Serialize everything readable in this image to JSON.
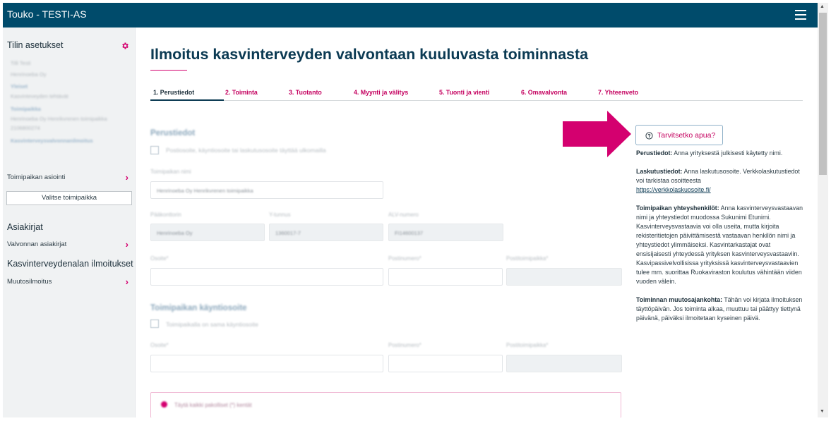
{
  "app": {
    "title": "Touko - TESTI-AS"
  },
  "sidebar": {
    "account_title": "Tilin asetukset",
    "account_blurred_lines": [
      "Tilli Testi",
      "Henrinoeba Oy",
      "Yleiset",
      "Kasvinteveyden tehtävät",
      "Toimipaikka",
      "Henrinoeba Oy Henrikvrenen toimipaikka",
      "2106800274",
      "Kasvinterveysvalvonnanilmoitus"
    ],
    "location_item": "Toimipaikan asiointi",
    "select_location_button": "Valitse toimipaikka",
    "documents_title": "Asiakirjat",
    "documents_item": "Valvonnan asiakirjat",
    "notifications_title": "Kasvinterveydenalan ilmoitukset",
    "notifications_item": "Muutosilmoitus"
  },
  "main": {
    "page_title": "Ilmoitus kasvinterveyden valvontaan kuuluvasta toiminnasta",
    "steps": [
      "1. Perustiedot",
      "2. Toiminta",
      "3. Tuotanto",
      "4. Myynti ja välitys",
      "5. Tuonti ja vienti",
      "6. Omavalvonta",
      "7. Yhteenveto"
    ],
    "form": {
      "section1_heading": "Perustiedot",
      "checkbox1_label": "Postiosoite, käyntiosoite tai laskutusosoite täyttää ulkomailla",
      "location_name_label": "Toimipaikan nimi",
      "location_name_value": "Henrinoeba Oy Henrikvrenen toimipaikka",
      "company_name_label": "Pääkonttorin",
      "company_name_value": "Henrinoeba Oy",
      "business_id_label": "Y-tunnus",
      "business_id_value": "1360017-7",
      "vat_label": "ALV-numero",
      "vat_value": "FI14600137",
      "address_label": "Osoite*",
      "postcode_label": "Postinumero*",
      "city_label": "Postitoimipaikka*",
      "section2_heading": "Toimipaikan käyntiosoite",
      "checkbox2_label": "Toimipaikalla on sama käyntiosoite",
      "address2_label": "Osoite*",
      "postcode2_label": "Postinumero*",
      "city2_label": "Postitoimipaikka*",
      "alert_text": "Täytä kaikki pakolliset (*) kentät"
    },
    "help": {
      "button_label": "Tarvitsetko apua?",
      "paragraphs": [
        {
          "title": "Perustiedot:",
          "text": " Anna yrityksestä julkisesti käytetty nimi."
        },
        {
          "title": "Laskutustiedot:",
          "text": " Anna laskutusosoite. Verkkolaskutustiedot voi tarkistaa osoitteesta",
          "link": "https://verkkolaskuosoite.fi/"
        },
        {
          "title": "Toimipaikan yhteyshenkilöt:",
          "text": " Anna kasvinterveysvastaavan nimi ja yhteystiedot muodossa Sukunimi Etunimi. Kasvinterveysvastaavia voi olla useita, mutta kirjoita rekisteritietojen päivittämisestä vastaavan henkilön nimi ja yhteystiedot ylimmäiseksi. Kasvintarkastajat ovat ensisijaisesti yhteydessä yrityksen kasvinterveysvastaaviin. Kasvipassivelvollisissa yrityksissä kasvinterveysvastaavien tulee mm. suorittaa Ruokaviraston koulutus vähintään viiden vuoden välein."
        },
        {
          "title": "Toiminnan muutosajankohta:",
          "text": " Tähän voi kirjata ilmoituksen täyttöpäivän. Jos toiminta alkaa, muuttuu tai päättyy tiettynä päivänä, päiväksi ilmoitetaan kyseinen päivä."
        }
      ]
    }
  },
  "colors": {
    "header_bg": "#004b6b",
    "accent": "#d4006f",
    "title": "#0b3a53",
    "sidebar_bg": "#f0f2f3"
  },
  "icons": [
    "menu-icon",
    "gear-icon",
    "chevron-right-icon",
    "help-circle-icon",
    "arrow-right-icon",
    "checkbox-icon"
  ]
}
